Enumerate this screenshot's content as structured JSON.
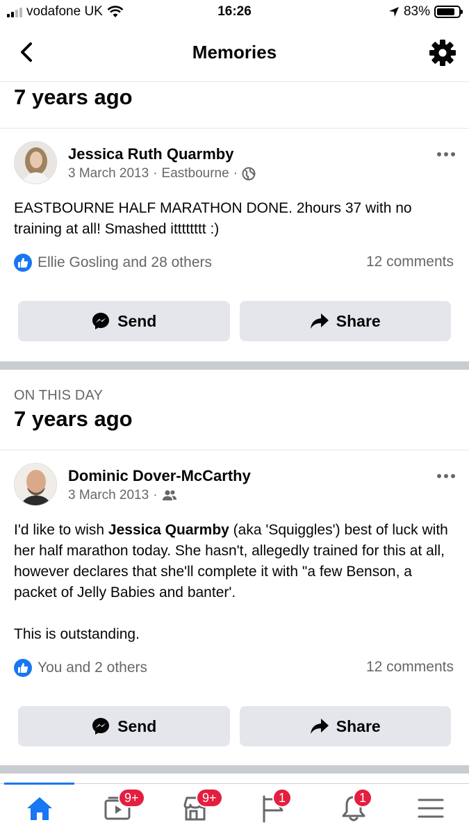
{
  "status_bar": {
    "carrier": "vodafone UK",
    "time": "16:26",
    "battery": "83%",
    "battery_level": 0.83
  },
  "nav": {
    "title": "Memories"
  },
  "sections": [
    {
      "heading": "7 years ago",
      "post": {
        "author": "Jessica Ruth Quarmby",
        "date": "3 March 2013",
        "location": "Eastbourne",
        "audience_icon": "globe-icon",
        "text": "EASTBOURNE HALF MARATHON DONE. 2hours 37 with no training at all! Smashed itttttttt :)",
        "likes": "Ellie Gosling and 28 others",
        "comments": "12 comments",
        "send_label": "Send",
        "share_label": "Share"
      }
    },
    {
      "eyebrow": "ON THIS DAY",
      "heading": "7 years ago",
      "post": {
        "author": "Dominic Dover-McCarthy",
        "date": "3 March 2013",
        "audience_icon": "friends-icon",
        "text_before": "I'd like to wish ",
        "text_mention": "Jessica Quarmby",
        "text_after": " (aka 'Squiggles') best of luck with her half marathon today. She hasn't, allegedly trained for this at all, however declares that she'll complete it with \"a few Benson, a packet of Jelly Babies and banter'.",
        "text_last": "This is outstanding.",
        "likes": "You and 2 others",
        "comments": "12 comments",
        "send_label": "Send",
        "share_label": "Share"
      }
    }
  ],
  "tabbar": {
    "watch_badge": "9+",
    "marketplace_badge": "9+",
    "pages_badge": "1",
    "notifications_badge": "1"
  },
  "colors": {
    "accent": "#1877f2",
    "badge": "#e41e3f",
    "button_bg": "#e4e6eb",
    "secondary_text": "#65676b"
  }
}
